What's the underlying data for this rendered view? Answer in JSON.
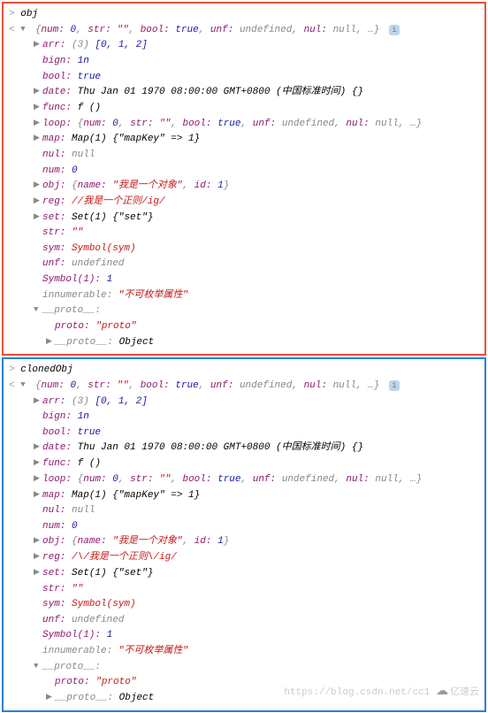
{
  "panels": [
    {
      "border": "red",
      "input": "obj",
      "summary_num": "0",
      "summary_str": "\"\"",
      "summary_bool": "true",
      "summary_unf": "undefined",
      "summary_nul": "null",
      "arr_count": "(3)",
      "arr_vals": "[0, 1, 2]",
      "bign": "1n",
      "bool": "true",
      "date": "Thu Jan 01 1970 08:00:00 GMT+0800 (中国标准时间) {}",
      "func": "f ()",
      "map": "Map(1) {\"mapKey\" => 1}",
      "nul": "null",
      "num": "0",
      "obj_name": "\"我是一个对象\"",
      "obj_id": "1",
      "reg": "//我是一个正则/ig/",
      "set": "Set(1) {\"set\"}",
      "str": "\"\"",
      "sym": "Symbol(sym)",
      "unf": "undefined",
      "symbol1": "1",
      "innumerable": "\"不可枚举属性\"",
      "proto_val": "\"proto\"",
      "proto_obj": "Object"
    },
    {
      "border": "blue",
      "input": "clonedObj",
      "summary_num": "0",
      "summary_str": "\"\"",
      "summary_bool": "true",
      "summary_unf": "undefined",
      "summary_nul": "null",
      "arr_count": "(3)",
      "arr_vals": "[0, 1, 2]",
      "bign": "1n",
      "bool": "true",
      "date": "Thu Jan 01 1970 08:00:00 GMT+0800 (中国标准时间) {}",
      "func": "f ()",
      "map": "Map(1) {\"mapKey\" => 1}",
      "nul": "null",
      "num": "0",
      "obj_name": "\"我是一个对象\"",
      "obj_id": "1",
      "reg": "/\\/我是一个正则\\/ig/",
      "set": "Set(1) {\"set\"}",
      "str": "\"\"",
      "sym": "Symbol(sym)",
      "unf": "undefined",
      "symbol1": "1",
      "innumerable": "\"不可枚举属性\"",
      "proto_val": "\"proto\"",
      "proto_obj": "Object"
    }
  ],
  "labels": {
    "num": "num:",
    "str": "str:",
    "bool": "bool:",
    "unf": "unf:",
    "nul": "nul:",
    "arr": "arr:",
    "bign": "bign:",
    "date": "date:",
    "func": "func:",
    "loop": "loop:",
    "map": "map:",
    "obj": "obj:",
    "name": "name:",
    "id": "id:",
    "reg": "reg:",
    "set": "set:",
    "sym": "sym:",
    "symbol1": "Symbol(1):",
    "innumerable": "innumerable:",
    "proto": "__proto__:",
    "proto_key": "proto:"
  },
  "watermark": {
    "url": "https://blog.csdn.net/cc1",
    "brand": "亿速云"
  }
}
